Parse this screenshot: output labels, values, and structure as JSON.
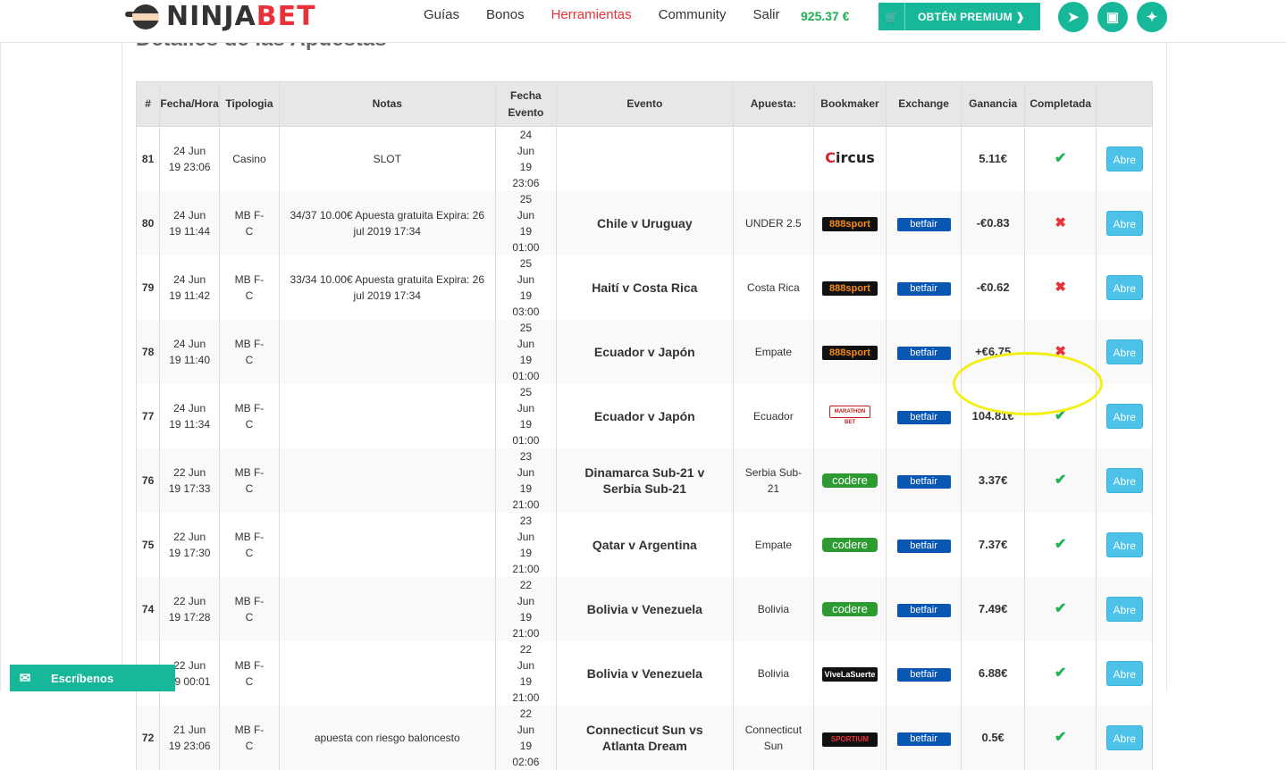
{
  "brand": {
    "ninja": "NINJA",
    "bet": "BET"
  },
  "nav": {
    "items": [
      {
        "label": "Guías",
        "active": false
      },
      {
        "label": "Bonos",
        "active": false
      },
      {
        "label": "Herramientas",
        "active": true
      },
      {
        "label": "Community",
        "active": false
      },
      {
        "label": "Salir",
        "active": false
      }
    ],
    "balance": "925.37 €",
    "premium_label": "OBTÉN PREMIUM ❱",
    "socials": [
      "telegram-icon",
      "instagram-icon",
      "twitter-icon"
    ]
  },
  "page": {
    "heading": "Detalles de las Apuestas"
  },
  "table": {
    "headers": [
      "#",
      "Fecha/Hora",
      "Tipologia",
      "Notas",
      "Fecha Evento",
      "Evento",
      "Apuesta:",
      "Bookmaker",
      "Exchange",
      "Ganancia",
      "Completada",
      ""
    ],
    "rows": [
      {
        "num": "81",
        "date": "24 Jun 19 23:06",
        "type": "Casino",
        "notes": "SLOT",
        "event_date": "24 Jun 19 23:06",
        "event": "",
        "bet": "",
        "bookmaker": "circus",
        "exchange": "",
        "gain": "5.11€",
        "gain_positive": true,
        "completed": true,
        "action": "Abre"
      },
      {
        "num": "80",
        "date": "24 Jun 19 11:44",
        "type": "MB F-C",
        "notes": "34/37 10.00€ Apuesta gratuita Expira: 26 jul 2019 17:34",
        "event_date": "25 Jun 19 01:00",
        "event": "Chile v Uruguay",
        "bet": "UNDER 2.5",
        "bookmaker": "888sport",
        "exchange": "betfair",
        "gain": "-€0.83",
        "gain_positive": false,
        "completed": false,
        "action": "Abre"
      },
      {
        "num": "79",
        "date": "24 Jun 19 11:42",
        "type": "MB F-C",
        "notes": "33/34 10.00€ Apuesta gratuita Expira: 26 jul 2019 17:34",
        "event_date": "25 Jun 19 03:00",
        "event": "Haití v Costa Rica",
        "bet": "Costa Rica",
        "bookmaker": "888sport",
        "exchange": "betfair",
        "gain": "-€0.62",
        "gain_positive": false,
        "completed": false,
        "action": "Abre"
      },
      {
        "num": "78",
        "date": "24 Jun 19 11:40",
        "type": "MB F-C",
        "notes": "",
        "event_date": "25 Jun 19 01:00",
        "event": "Ecuador v Japón",
        "bet": "Empate",
        "bookmaker": "888sport",
        "exchange": "betfair",
        "gain": "+€6.75",
        "gain_positive": false,
        "completed": false,
        "action": "Abre"
      },
      {
        "num": "77",
        "date": "24 Jun 19 11:34",
        "type": "MB F-C",
        "notes": "",
        "event_date": "25 Jun 19 01:00",
        "event": "Ecuador v Japón",
        "bet": "Ecuador",
        "bookmaker": "marathonbet",
        "exchange": "betfair",
        "gain": "104.81€",
        "gain_positive": true,
        "completed": true,
        "action": "Abre"
      },
      {
        "num": "76",
        "date": "22 Jun 19 17:33",
        "type": "MB F-C",
        "notes": "",
        "event_date": "23 Jun 19 21:00",
        "event": "Dinamarca Sub-21 v Serbia Sub-21",
        "bet": "Serbia Sub-21",
        "bookmaker": "codere",
        "exchange": "betfair",
        "gain": "3.37€",
        "gain_positive": true,
        "completed": true,
        "action": "Abre"
      },
      {
        "num": "75",
        "date": "22 Jun 19 17:30",
        "type": "MB F-C",
        "notes": "",
        "event_date": "23 Jun 19 21:00",
        "event": "Qatar v Argentina",
        "bet": "Empate",
        "bookmaker": "codere",
        "exchange": "betfair",
        "gain": "7.37€",
        "gain_positive": true,
        "completed": true,
        "action": "Abre"
      },
      {
        "num": "74",
        "date": "22 Jun 19 17:28",
        "type": "MB F-C",
        "notes": "",
        "event_date": "22 Jun 19 21:00",
        "event": "Bolivia v Venezuela",
        "bet": "Bolivia",
        "bookmaker": "codere",
        "exchange": "betfair",
        "gain": "7.49€",
        "gain_positive": true,
        "completed": true,
        "action": "Abre"
      },
      {
        "num": "73",
        "date": "22 Jun 19 00:01",
        "type": "MB F-C",
        "notes": "",
        "event_date": "22 Jun 19 21:00",
        "event": "Bolivia v Venezuela",
        "bet": "Bolivia",
        "bookmaker": "vivelasuerte",
        "exchange": "betfair",
        "gain": "6.88€",
        "gain_positive": true,
        "completed": true,
        "action": "Abre"
      },
      {
        "num": "72",
        "date": "21 Jun 19 23:06",
        "type": "MB F-C",
        "notes": "apuesta con riesgo baloncesto",
        "event_date": "22 Jun 19 02:06",
        "event": "Connecticut Sun vs Atlanta Dream",
        "bet": "Connecticut Sun",
        "bookmaker": "sportium",
        "exchange": "betfair",
        "gain": "0.5€",
        "gain_positive": true,
        "completed": true,
        "action": "Abre"
      }
    ]
  },
  "logos": {
    "circus": "Circus",
    "888sport": "888sport",
    "marathonbet": "MARATHON BET",
    "codere": "codere",
    "vivelasuerte": "ViveLaSuerte",
    "sportium": "SPORTIUM",
    "betfair": "betfair"
  },
  "chat": {
    "label": "Escríbenos"
  }
}
